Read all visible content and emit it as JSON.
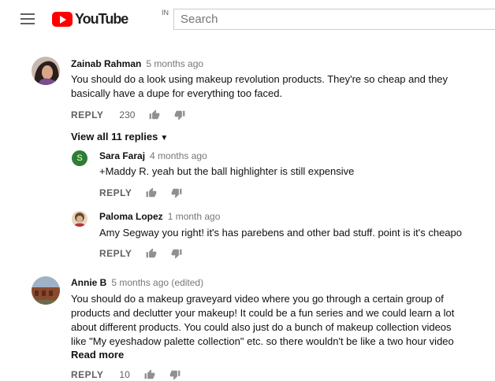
{
  "header": {
    "logo_text": "YouTube",
    "logo_region": "IN",
    "search_placeholder": "Search"
  },
  "comments": [
    {
      "author": "Zainab Rahman",
      "time": "5 months ago",
      "text": "You should do a look using makeup revolution products. They're so cheap and they basically have a dupe for everything too faced.",
      "reply_label": "REPLY",
      "likes": "230"
    },
    {
      "author": "Annie B",
      "time": "5 months ago (edited)",
      "text": "You should do a makeup graveyard video where you go through a certain group of products and declutter your makeup! It could be a fun series and we could learn a lot about different products. You could also just do a bunch of makeup collection videos like \"My eyeshadow palette collection\" etc. so there wouldn't be like a two hour video of",
      "read_more": "Read more",
      "reply_label": "REPLY",
      "likes": "10"
    }
  ],
  "view_replies": "View all 11 replies",
  "replies": [
    {
      "author": "Sara Faraj",
      "time": "4 months ago",
      "avatar_letter": "S",
      "avatar_color": "#2e7d32",
      "text": "+Maddy R. yeah but the ball highlighter is still expensive",
      "reply_label": "REPLY"
    },
    {
      "author": "Paloma Lopez",
      "time": "1 month ago",
      "text": "Amy Segway you right! it's has parebens and other bad stuff. point is it's cheapo",
      "reply_label": "REPLY"
    }
  ]
}
